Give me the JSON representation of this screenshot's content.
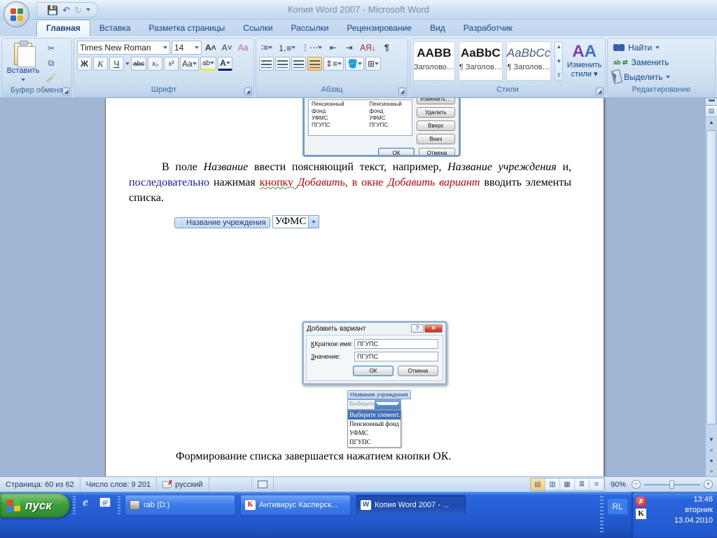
{
  "title_bar": {
    "title": "Копия Word 2007  -  Microsoft Word"
  },
  "tabs": [
    {
      "label": "Главная"
    },
    {
      "label": "Вставка"
    },
    {
      "label": "Разметка страницы"
    },
    {
      "label": "Ссылки"
    },
    {
      "label": "Рассылки"
    },
    {
      "label": "Рецензирование"
    },
    {
      "label": "Вид"
    },
    {
      "label": "Разработчик"
    }
  ],
  "ribbon": {
    "clipboard": {
      "paste": "Вставить",
      "label": "Буфер обмена"
    },
    "font": {
      "family": "Times New Roman",
      "size": "14",
      "label": "Шрифт",
      "bold": "Ж",
      "italic": "К",
      "underline": "Ч",
      "strike": "abc",
      "subscript": "x₂",
      "superscript": "x²",
      "change_case": "Aa",
      "highlight": "ab",
      "color": "А",
      "clear": "Аа"
    },
    "paragraph": {
      "label": "Абзац",
      "sort": "АЯ",
      "pilcrow": "¶"
    },
    "styles": {
      "label": "Стили",
      "items": [
        {
          "preview": "AABB",
          "name": "Заголово…"
        },
        {
          "preview": "AaBbC",
          "name": "¶ Заголов…"
        },
        {
          "preview": "AaBbCc",
          "name": "¶ Заголов…"
        }
      ],
      "change": "Изменить стили",
      "change_icon": "АА"
    },
    "editing": {
      "label": "Редактирование",
      "find": "Найти",
      "replace": "Заменить",
      "select": "Выделить",
      "replace_icon": "ab ⇄"
    }
  },
  "document": {
    "dialog_top": {
      "list_col1": [
        "Пенсионный фонд",
        "УФМС",
        "ПГУПС"
      ],
      "list_col2": [
        "Пенсионный фонд",
        "УФМС",
        "ПГУПС"
      ],
      "btn_edit": "Изменить…",
      "btn_delete": "Удалить",
      "btn_up": "Вверх",
      "btn_down": "Вниз",
      "ok": "ОК",
      "cancel": "Отмена"
    },
    "paragraph": {
      "segments": [
        {
          "text": "В поле "
        },
        {
          "text": "Название"
        },
        {
          "text": " ввести поясняющий текст, например, "
        },
        {
          "text": "Название учреждения"
        },
        {
          "text": " и, "
        },
        {
          "text": "последовательно"
        },
        {
          "text": "  нажимая "
        },
        {
          "text": "кнопку "
        },
        {
          "text": "Добавить,"
        },
        {
          "text": " в окне "
        },
        {
          "text": "Добавить вариант"
        },
        {
          "text": " вводить элементы списка."
        }
      ]
    },
    "content_control": {
      "tag": "Название учреждения",
      "value": "УФМС"
    },
    "dialog_add": {
      "title": "Добавить вариант",
      "help": "?",
      "close": "✕",
      "name_label": "Краткое имя:",
      "name_value": "ПГУПС",
      "value_label": "Значение:",
      "value_value": "ПГУПС",
      "ok": "ОК",
      "cancel": "Отмена"
    },
    "dropdown_shot": {
      "tag": "Название учреждения",
      "field": "Выберите элемент.",
      "items": [
        "Выберите элемент.",
        "Пенсионный фонд",
        "УФМС",
        "ПГУПС"
      ]
    },
    "closing_line": "Формирование списка завершается нажатием кнопки ОК."
  },
  "status_bar": {
    "page": "Страница: 60 из 62",
    "words": "Число слов: 9 201",
    "language": "русский",
    "zoom": "90%"
  },
  "taskbar": {
    "start": "пуск",
    "button_drive": "rab (D:)",
    "button_kav": "Антивирус Касперск...",
    "button_word": "Копия Word 2007 - ...",
    "lang": "RL",
    "time": "13:46",
    "day": "вторник",
    "date": "13.04.2010"
  }
}
